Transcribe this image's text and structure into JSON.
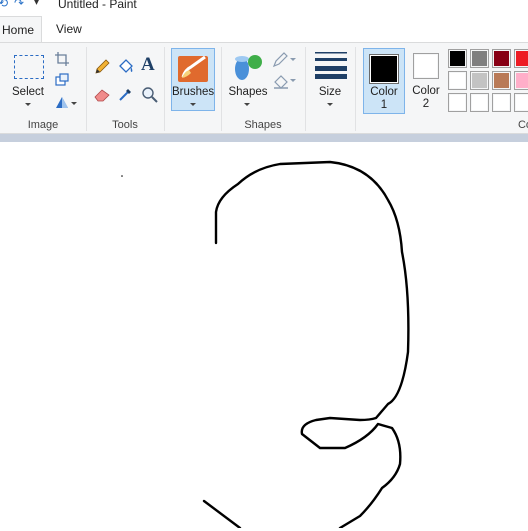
{
  "window": {
    "title": "Untitled - Paint"
  },
  "tabs": [
    {
      "label": "Home"
    },
    {
      "label": "View"
    }
  ],
  "ribbon": {
    "image_group": {
      "label": "Image",
      "select_label": "Select"
    },
    "tools_group": {
      "label": "Tools"
    },
    "brushes_label": "Brushes",
    "shapes_group": {
      "label": "Shapes",
      "shapes_button_label": "Shapes"
    },
    "size_label": "Size",
    "color1_label": "Color\n1",
    "color1_line1": "Color",
    "color1_line2": "1",
    "color2_line1": "Color",
    "color2_line2": "2",
    "colors_group_label_partial": "Co",
    "color1_value": "#000000",
    "color2_value": "#ffffff",
    "palette_row1": [
      "#000000",
      "#7f7f7f",
      "#880015",
      "#ed1c24"
    ],
    "palette_row2": [
      "#ffffff",
      "#c3c3c3",
      "#b97a57",
      "#ffaec9"
    ],
    "palette_row3": [
      "#ffffff",
      "#ffffff",
      "#ffffff",
      "#ffffff"
    ]
  },
  "canvas": {
    "background": "#ffffff",
    "stroke_color": "#000000",
    "drawing": "freehand black stroke"
  }
}
